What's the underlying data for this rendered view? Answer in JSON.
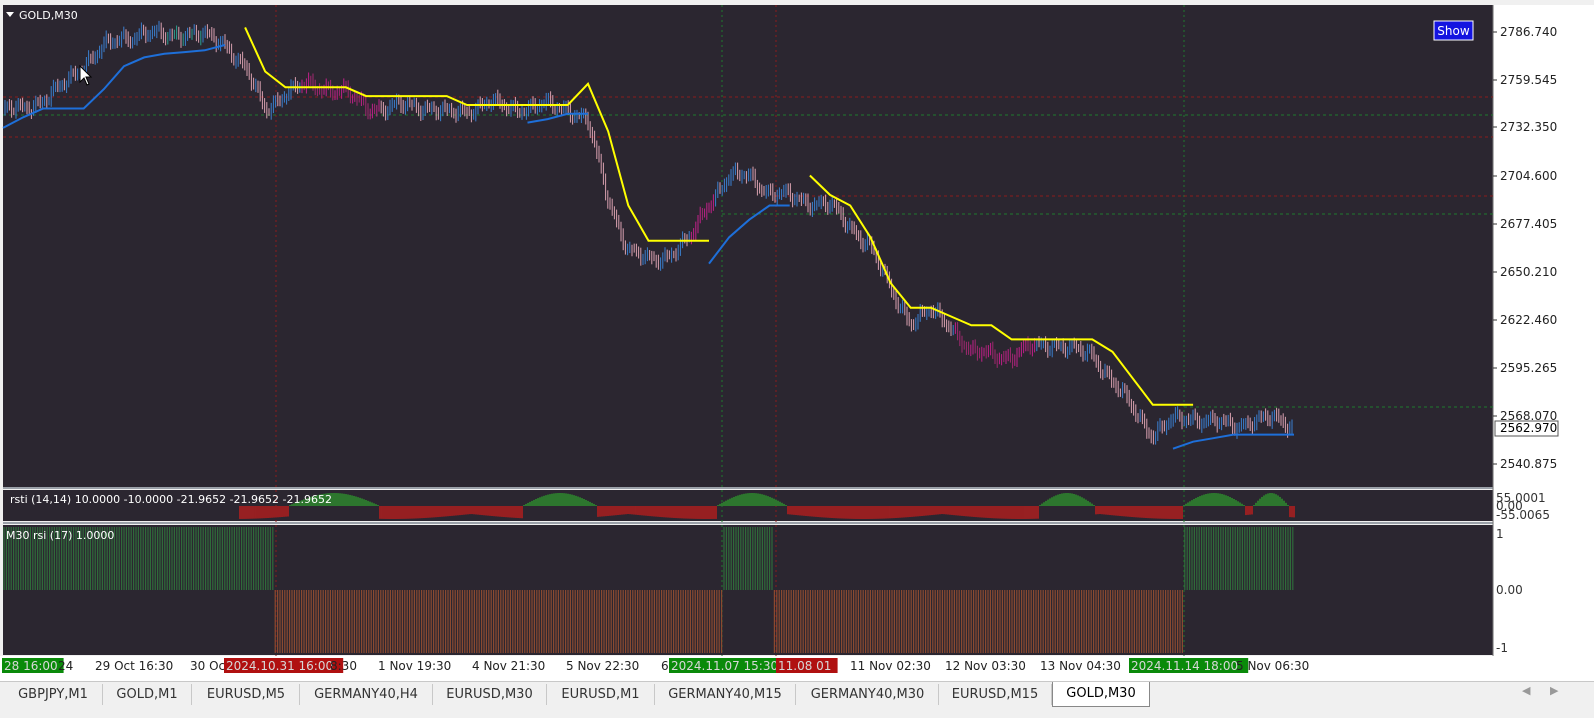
{
  "window": {
    "title": "GOLD,M30",
    "show_button": "Show",
    "current_price": "2562.970"
  },
  "price_axis": [
    "2786.740",
    "2759.545",
    "2732.350",
    "2704.600",
    "2677.405",
    "2650.210",
    "2622.460",
    "2595.265",
    "2568.070",
    "2540.875"
  ],
  "time_axis": [
    {
      "label": "28 16:00",
      "highlight": "green"
    },
    {
      "label": "24",
      "highlight": ""
    },
    {
      "label": "29 Oct 16:30",
      "highlight": ""
    },
    {
      "label": "30 Oc",
      "highlight": ""
    },
    {
      "label": "2024.10.31 16:00",
      "highlight": "red"
    },
    {
      "label": "8:30",
      "highlight": ""
    },
    {
      "label": "1 Nov 19:30",
      "highlight": ""
    },
    {
      "label": "4 Nov 21:30",
      "highlight": ""
    },
    {
      "label": "5 Nov 22:30",
      "highlight": ""
    },
    {
      "label": "6",
      "highlight": ""
    },
    {
      "label": "2024.11.07 15:30",
      "highlight": "green"
    },
    {
      "label": "11.08 01",
      "highlight": "red"
    },
    {
      "label": "11 Nov 02:30",
      "highlight": ""
    },
    {
      "label": "12 Nov 03:30",
      "highlight": ""
    },
    {
      "label": "13 Nov 04:30",
      "highlight": ""
    },
    {
      "label": "2024.11.14 18:00",
      "highlight": "green"
    },
    {
      "label": "5 Nov 06:30",
      "highlight": ""
    }
  ],
  "rsti_panel": {
    "label": "rsti (14,14) 10.0000 -10.0000 -21.9652 -21.9652 -21.9652",
    "axis": [
      "55.0001",
      "0.00",
      "-55.0065"
    ]
  },
  "rsi_panel": {
    "label": "M30 rsi  (17) 1.0000",
    "axis": [
      "1",
      "0.00",
      "-1"
    ]
  },
  "tabs": [
    {
      "label": "GBPJPY,M1",
      "active": false
    },
    {
      "label": "GOLD,M1",
      "active": false
    },
    {
      "label": "EURUSD,M5",
      "active": false
    },
    {
      "label": "GERMANY40,H4",
      "active": false
    },
    {
      "label": "EURUSD,M30",
      "active": false
    },
    {
      "label": "EURUSD,M1",
      "active": false
    },
    {
      "label": "GERMANY40,M15",
      "active": false
    },
    {
      "label": "GERMANY40,M30",
      "active": false
    },
    {
      "label": "EURUSD,M15",
      "active": false
    },
    {
      "label": "GOLD,M30",
      "active": true
    }
  ],
  "colors": {
    "background": "#2b2630",
    "axis_bg": "#ffffff",
    "upper_band": "#ffff00",
    "lower_band": "#1e6fd9",
    "bar_up": "#3a7fcf",
    "bar_down": "#d9a0b0",
    "bar_magenta": "#c0208a",
    "bar_teal": "#2aa090",
    "rsti_pos": "#2e8b2e",
    "rsti_neg": "#b21e1e",
    "rsi_pos": "#2f6b3a",
    "rsi_neg": "#8a4a30"
  },
  "chart_data": {
    "type": "line",
    "title": "GOLD,M30",
    "ylim": [
      2530,
      2800
    ],
    "x": [
      0,
      1,
      2,
      3,
      4,
      5,
      6,
      7,
      8,
      9,
      10,
      11,
      12,
      13,
      14,
      15,
      16,
      17,
      18,
      19,
      20,
      21,
      22,
      23,
      24,
      25,
      26,
      27,
      28,
      29,
      30,
      31,
      32,
      33,
      34,
      35,
      36,
      37,
      38,
      39,
      40,
      41,
      42,
      43,
      44,
      45,
      46,
      47,
      48,
      49,
      50,
      51,
      52,
      53,
      54,
      55,
      56,
      57,
      58,
      59,
      60,
      61,
      62,
      63,
      64
    ],
    "series": [
      {
        "name": "close",
        "values": [
          2742,
          2743,
          2748,
          2756,
          2768,
          2778,
          2783,
          2786,
          2784,
          2786,
          2784,
          2780,
          2766,
          2742,
          2752,
          2756,
          2755,
          2752,
          2744,
          2743,
          2745,
          2744,
          2740,
          2742,
          2746,
          2744,
          2743,
          2745,
          2743,
          2735,
          2692,
          2662,
          2657,
          2660,
          2668,
          2690,
          2704,
          2705,
          2695,
          2693,
          2690,
          2688,
          2676,
          2665,
          2640,
          2622,
          2628,
          2620,
          2604,
          2604,
          2602,
          2608,
          2610,
          2606,
          2604,
          2588,
          2573,
          2558,
          2566,
          2568,
          2565,
          2563,
          2566,
          2567,
          2563
        ]
      },
      {
        "name": "upper",
        "values": [
          null,
          null,
          null,
          null,
          null,
          null,
          null,
          null,
          null,
          null,
          null,
          null,
          2789,
          2764,
          2755,
          2755,
          2755,
          2755,
          2750,
          2750,
          2750,
          2750,
          2750,
          2745,
          2745,
          2745,
          2745,
          2745,
          2745,
          2757,
          2730,
          2688,
          2668,
          2668,
          2668,
          2668,
          null,
          null,
          null,
          null,
          2705,
          2694,
          2688,
          2670,
          2644,
          2630,
          2630,
          2625,
          2620,
          2620,
          2612,
          2612,
          2612,
          2612,
          2612,
          2605,
          2590,
          2575,
          2575,
          2575,
          null,
          null,
          null,
          null,
          null
        ]
      },
      {
        "name": "lower",
        "values": [
          2732,
          2738,
          2743,
          2743,
          2743,
          2754,
          2767,
          2772,
          2774,
          2775,
          2776,
          2779,
          null,
          null,
          null,
          null,
          null,
          null,
          null,
          null,
          null,
          null,
          null,
          null,
          null,
          null,
          2735,
          2737,
          2740,
          2740,
          null,
          null,
          null,
          null,
          null,
          2655,
          2670,
          2680,
          2688,
          2688,
          null,
          null,
          null,
          null,
          null,
          null,
          null,
          null,
          null,
          null,
          null,
          null,
          null,
          null,
          null,
          null,
          null,
          null,
          2550,
          2554,
          2556,
          2558,
          2558,
          2558,
          2558
        ]
      }
    ]
  }
}
